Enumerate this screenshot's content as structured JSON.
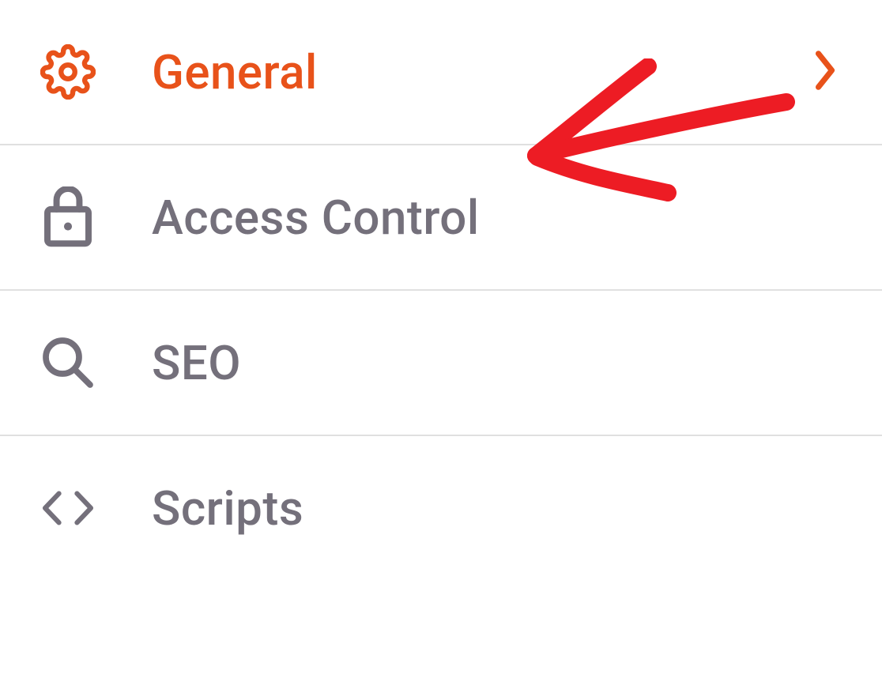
{
  "menu": {
    "items": [
      {
        "label": "General",
        "icon": "gear-icon",
        "active": true,
        "hasChevron": true
      },
      {
        "label": "Access Control",
        "icon": "lock-icon",
        "active": false,
        "hasChevron": false
      },
      {
        "label": "SEO",
        "icon": "search-icon",
        "active": false,
        "hasChevron": false
      },
      {
        "label": "Scripts",
        "icon": "code-icon",
        "active": false,
        "hasChevron": false
      }
    ]
  },
  "colors": {
    "active": "#e8521a",
    "inactive": "#74707b",
    "annotation": "#ed1c24"
  }
}
